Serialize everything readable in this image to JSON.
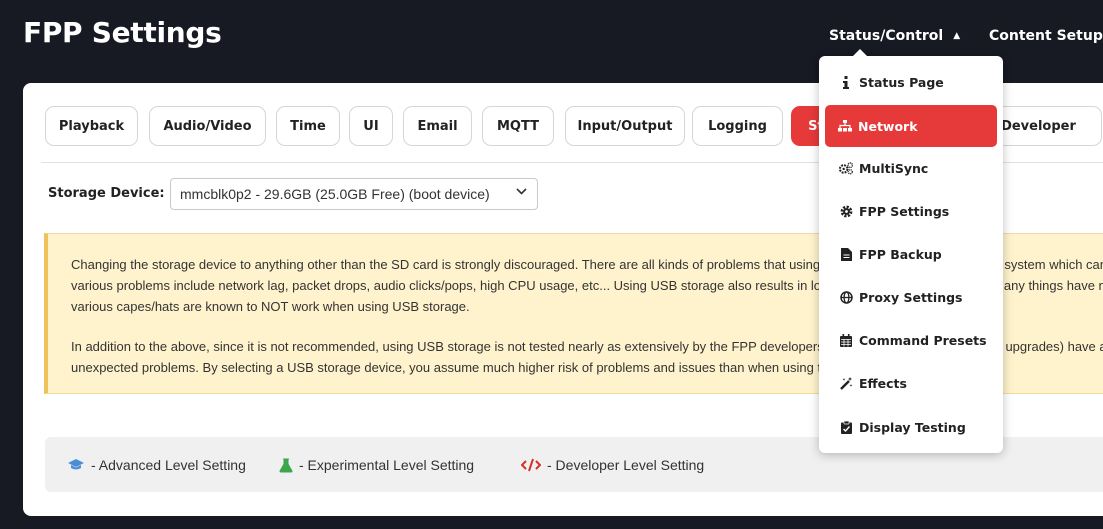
{
  "header": {
    "title": "FPP Settings",
    "nav": {
      "status_control": "Status/Control",
      "content_setup": "Content Setup"
    }
  },
  "tabs": [
    {
      "label": "Playback"
    },
    {
      "label": "Audio/Video"
    },
    {
      "label": "Time"
    },
    {
      "label": "UI"
    },
    {
      "label": "Email"
    },
    {
      "label": "MQTT"
    },
    {
      "label": "Input/Output"
    },
    {
      "label": "Logging"
    },
    {
      "label": "Storage",
      "active": true
    },
    {
      "label": "Developer"
    }
  ],
  "storage": {
    "label": "Storage Device:",
    "selected": "mmcblk0p2 - 29.6GB (25.0GB Free) (boot device)"
  },
  "warning": {
    "para1": [
      "Changing the storage device to anything other than the SD card is strongly discouraged. There are all kinds of problems that using USB storage introduce into the system which can easily result in",
      "various problems include network lag, packet drops, audio clicks/pops, high CPU usage, etc... Using USB storage also results in longer bootup time. In addition, many things have not been tested on USB storage. In addition,",
      "various capes/hats are known to NOT work when using USB storage."
    ],
    "para2": [
      "In addition to the above, since it is not recommended, using USB storage is not tested nearly as extensively by the FPP developers. Thus, upgrades (even \"patch\" upgrades) have a much higher chance of",
      "unexpected problems. By selecting a USB storage device, you assume much higher risk of problems and issues than when using the SD card partition."
    ]
  },
  "legend": {
    "advanced": "- Advanced Level Setting",
    "experimental": "- Experimental Level Setting",
    "developer": "- Developer Level Setting"
  },
  "dropdown_menu": [
    {
      "label": "Status Page",
      "icon": "info-icon"
    },
    {
      "label": "Network",
      "icon": "network-icon",
      "active": true
    },
    {
      "label": "MultiSync",
      "icon": "cogs-icon"
    },
    {
      "label": "FPP Settings",
      "icon": "gear-icon"
    },
    {
      "label": "FPP Backup",
      "icon": "file-icon"
    },
    {
      "label": "Proxy Settings",
      "icon": "globe-icon"
    },
    {
      "label": "Command Presets",
      "icon": "calendar-icon"
    },
    {
      "label": "Effects",
      "icon": "magic-wand-icon"
    },
    {
      "label": "Display Testing",
      "icon": "clipboard-check-icon"
    }
  ],
  "colors": {
    "topbar": "#171923",
    "accent": "#e63a3a",
    "warning_bg": "#fff3cd",
    "warning_border": "#f0c35a",
    "advanced": "#4a8fd6",
    "experimental": "#3da64a",
    "developer": "#d93025"
  }
}
